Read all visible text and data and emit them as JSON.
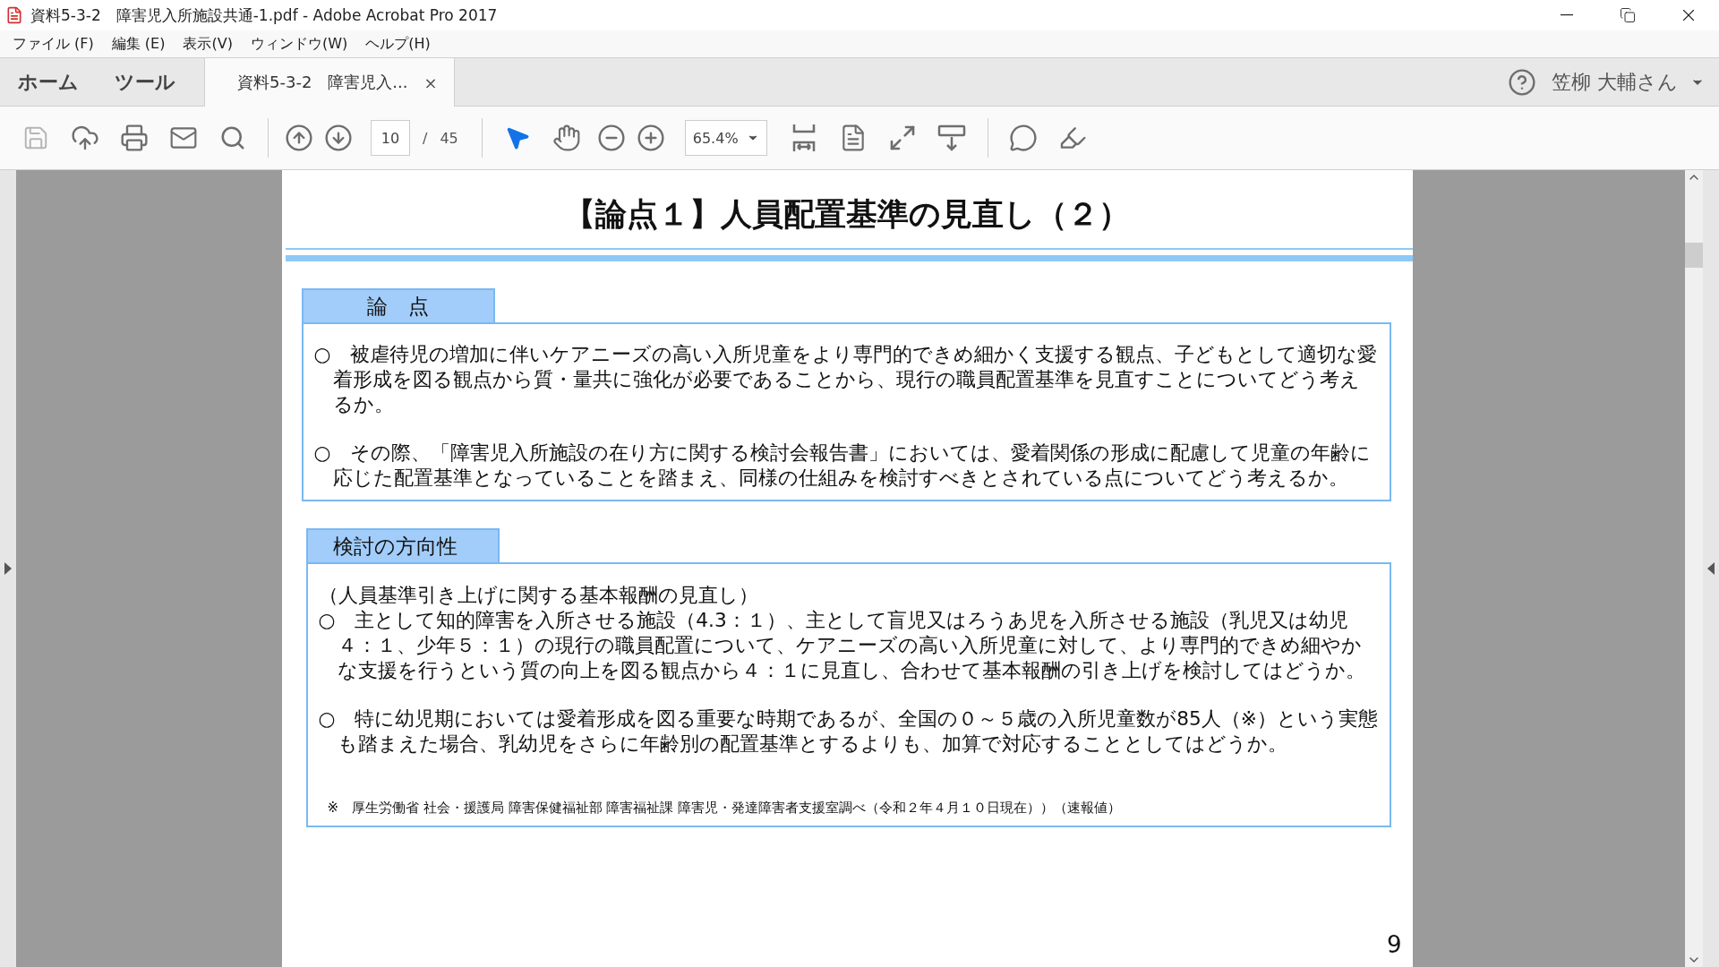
{
  "window": {
    "title": "資料5-3-2　障害児入所施設共通-1.pdf - Adobe Acrobat Pro 2017"
  },
  "menu": [
    "ファイル (F)",
    "編集 (E)",
    "表示(V)",
    "ウィンドウ(W)",
    "ヘルプ(H)"
  ],
  "tabs": [
    {
      "label": "ホーム",
      "selected": false,
      "kind": "nav"
    },
    {
      "label": "ツール",
      "selected": false,
      "kind": "nav"
    },
    {
      "label": "資料5-3-2　障害児入...",
      "selected": true,
      "kind": "document",
      "close": "×"
    }
  ],
  "user": {
    "name": "笠柳 大輔さん"
  },
  "toolbar": {
    "page": "10",
    "separator": "/",
    "total": "45",
    "zoom": "65.4%",
    "tools": [
      {
        "kind": "select",
        "selected": true
      },
      {
        "kind": "hand",
        "selected": false
      }
    ]
  },
  "document": {
    "title": "【論点１】人員配置基準の見直し（２）",
    "sections": [
      {
        "heading": "論　点",
        "paragraphs": [
          "○　被虐待児の増加に伴いケアニーズの高い入所児童をより専門的できめ細かく支援する観点、子どもとして適切な愛着形成を図る観点から質・量共に強化が必要であることから、現行の職員配置基準を見直すことについてどう考えるか。",
          "○　その際、「障害児入所施設の在り方に関する検討会報告書」においては、愛着関係の形成に配慮して児童の年齢に応じた配置基準となっていることを踏まえ、同様の仕組みを検討すべきとされている点についてどう考えるか。"
        ]
      },
      {
        "heading": "検討の方向性",
        "subheading": "（人員基準引き上げに関する基本報酬の見直し）",
        "paragraphs": [
          "○　主として知的障害を入所させる施設（4.3：１）、主として盲児又はろうあ児を入所させる施設（乳児又は幼児４：１、少年５：１）の現行の職員配置について、ケアニーズの高い入所児童に対して、より専門的できめ細やかな支援を行うという質の向上を図る観点から４：１に見直し、合わせて基本報酬の引き上げを検討してはどうか。",
          "○　特に幼児期においては愛着形成を図る重要な時期であるが、全国の０～５歳の入所児童数が85人（※）という実態も踏まえた場合、乳幼児をさらに年齢別の配置基準とするよりも、加算で対応することとしてはどうか。"
        ],
        "note": "※　厚生労働省 社会・援護局 障害保健福祉部 障害福祉課 障害児・発達障害者支援室調べ（令和２年４月１０日現在））（速報値）"
      }
    ],
    "page_number": "9"
  }
}
